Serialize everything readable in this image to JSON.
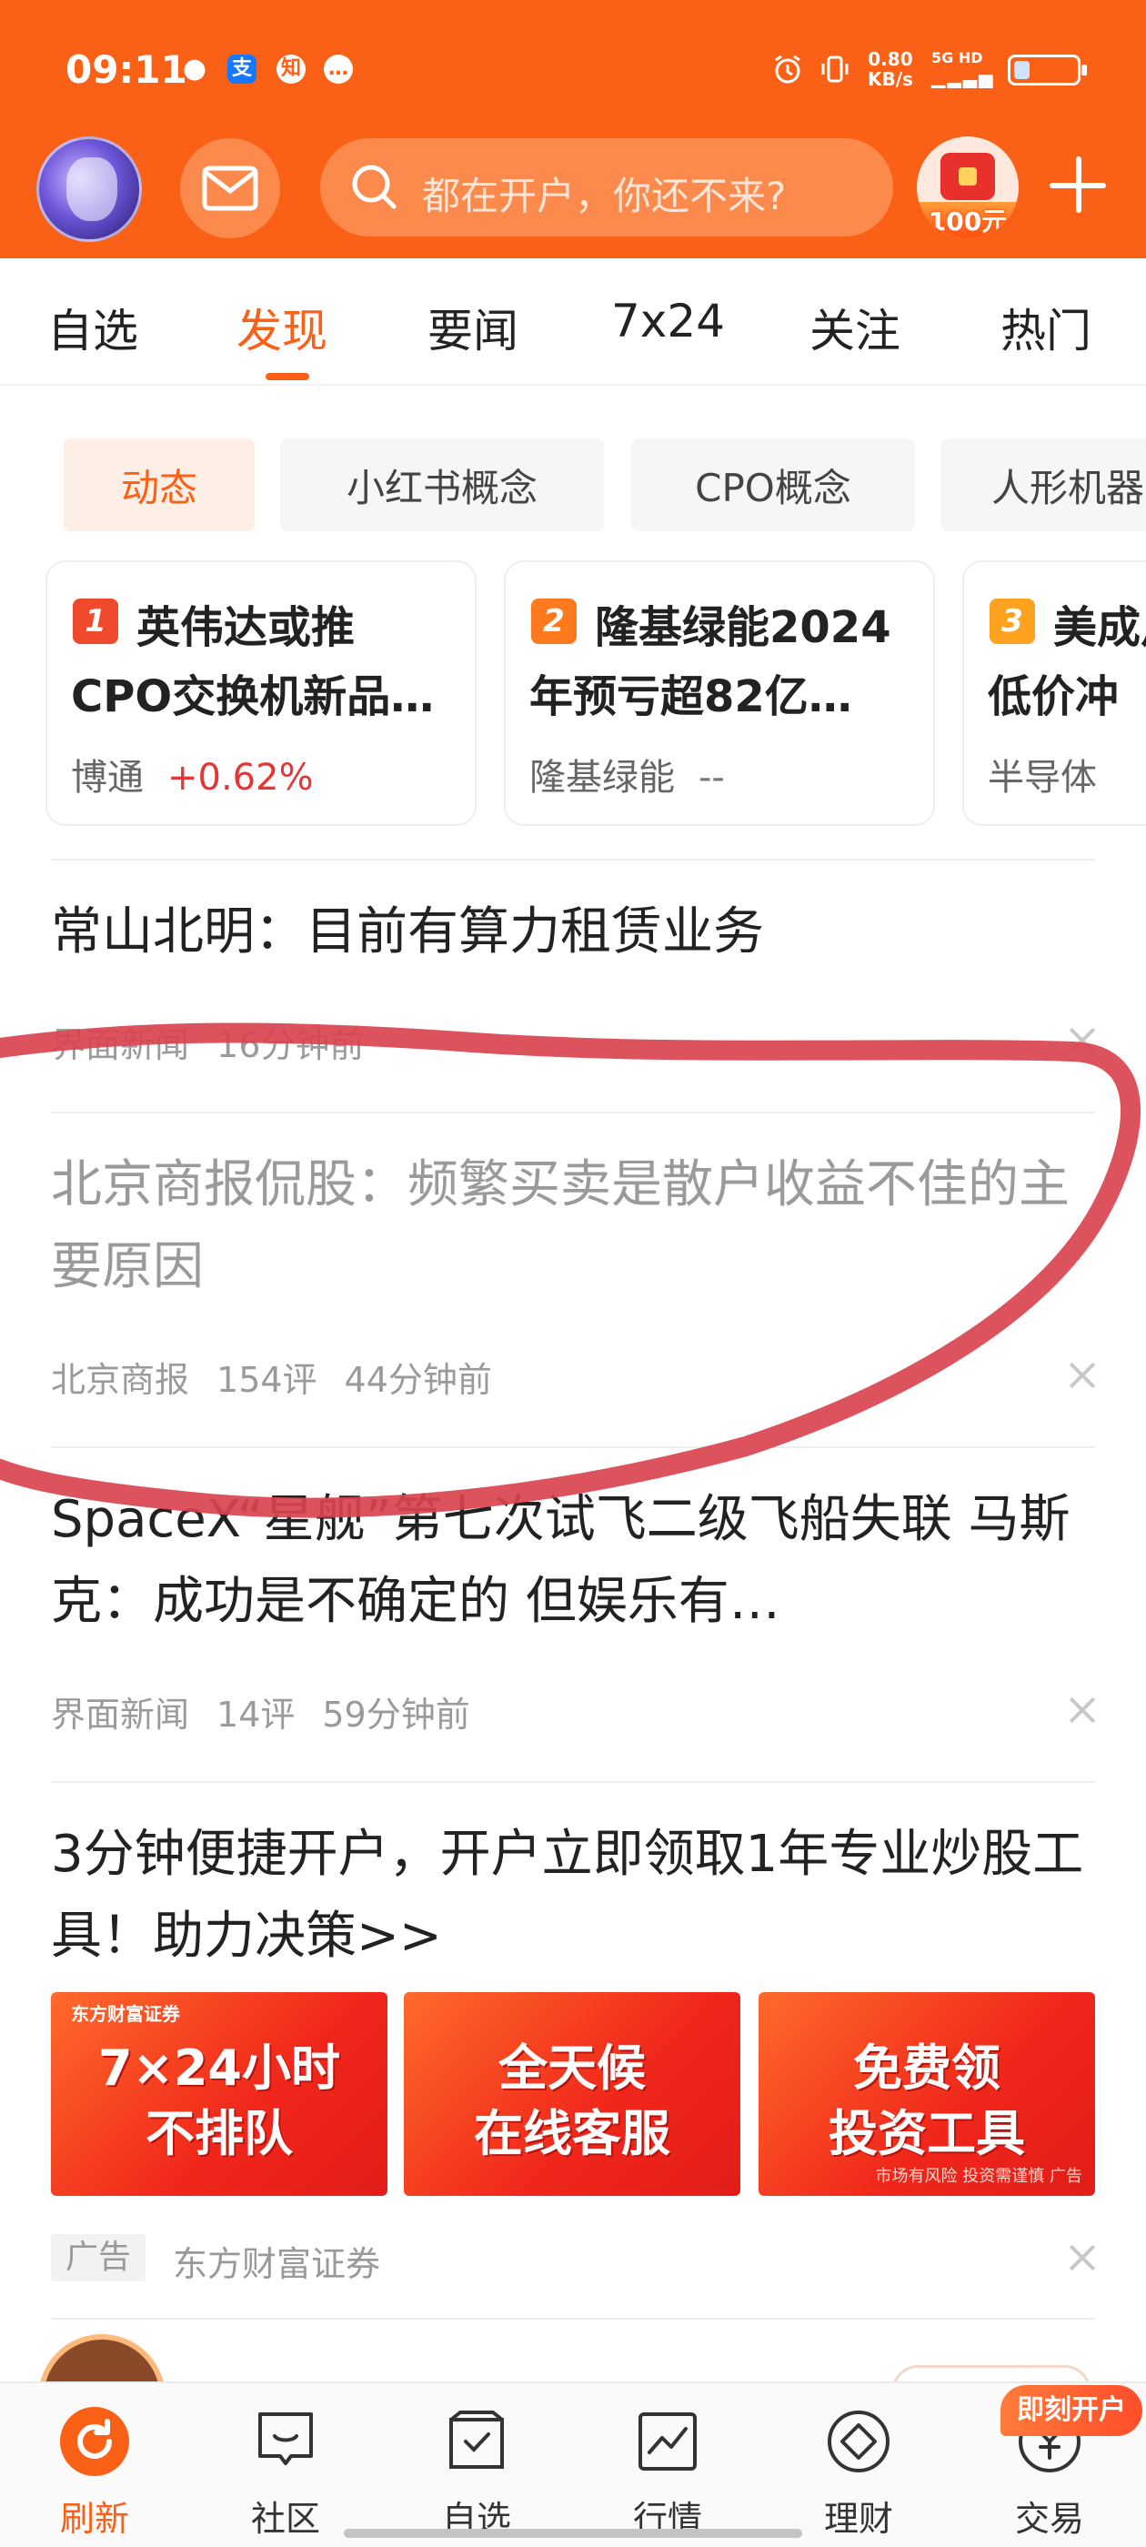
{
  "status_bar": {
    "time": "09:11",
    "net_speed_value": "0.80",
    "net_speed_unit": "KB/s",
    "signal": "5G HD",
    "battery_level": 0.25,
    "app_icons": [
      "wechat-icon",
      "alipay-icon",
      "zhihu-icon",
      "message-icon"
    ]
  },
  "header": {
    "search_placeholder": "都在开户，你还不来?",
    "reward_label": "100元"
  },
  "tabs": [
    "自选",
    "发现",
    "要闻",
    "7x24",
    "关注",
    "热门"
  ],
  "active_tab": "发现",
  "chips": [
    "动态",
    "小红书概念",
    "CPO概念",
    "人形机器"
  ],
  "hot_cards": [
    {
      "rank": "1",
      "title": "英伟达或推CPO交换机新品…",
      "stock": "博通",
      "change": "+0.62%",
      "rank_color": "#f04a2e"
    },
    {
      "rank": "2",
      "title": "隆基绿能2024年预亏超82亿…",
      "stock": "隆基绿能",
      "change": "--",
      "rank_color": "#ff7a1f"
    },
    {
      "rank": "3",
      "title": "美成片低价冲",
      "stock": "半导体",
      "change": "",
      "rank_color": "#ffa21f"
    }
  ],
  "news": [
    {
      "title": "常山北明：目前有算力租赁业务",
      "source": "界面新闻",
      "comments": "",
      "time": "16分钟前"
    },
    {
      "title": "北京商报侃股：频繁买卖是散户收益不佳的主要原因",
      "source": "北京商报",
      "comments": "154评",
      "time": "44分钟前"
    },
    {
      "title": "SpaceX“星舰”第七次试飞二级飞船失联 马斯克：成功是不确定的 但娱乐有…",
      "source": "界面新闻",
      "comments": "14评",
      "time": "59分钟前"
    }
  ],
  "ad": {
    "title": "3分钟便捷开户，开户立即领取1年专业炒股工具！助力决策>>",
    "banners": [
      {
        "line1": "7×24小时",
        "line2": "不排队"
      },
      {
        "line1": "全天候",
        "line2": "在线客服"
      },
      {
        "line1": "免费领",
        "line2": "投资工具"
      }
    ],
    "brand_logo": "东方财富证券",
    "risk_note": "市场有风险 投资需谨慎 广告",
    "tag": "广告",
    "source": "东方财富证券"
  },
  "bottom_nav": [
    {
      "label": "刷新",
      "icon": "refresh-icon"
    },
    {
      "label": "社区",
      "icon": "community-icon"
    },
    {
      "label": "自选",
      "icon": "watchlist-icon"
    },
    {
      "label": "行情",
      "icon": "market-icon"
    },
    {
      "label": "理财",
      "icon": "wealth-icon"
    },
    {
      "label": "交易",
      "icon": "trade-icon"
    }
  ],
  "open_account_badge": "即刻开户",
  "colors": {
    "brand": "#fb6116",
    "up": "#e33636",
    "annotation": "#d9434f"
  }
}
